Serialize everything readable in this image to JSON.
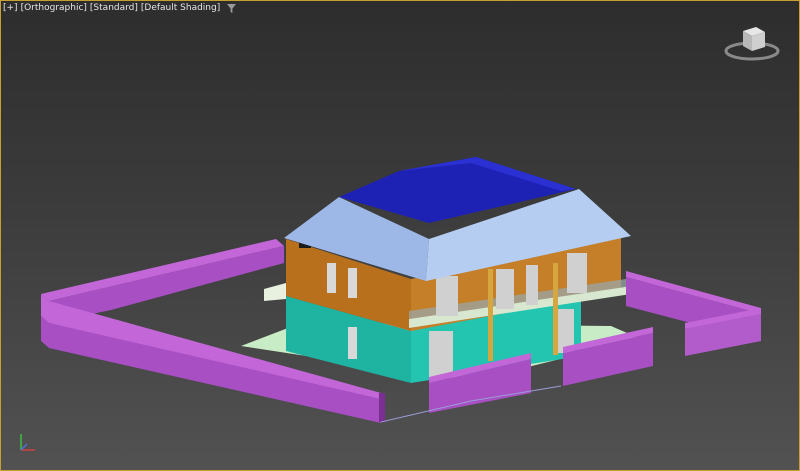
{
  "viewport": {
    "labels": [
      "[+]",
      "[Orthographic]",
      "[Standard]",
      "[Default Shading]"
    ],
    "filter_icon": "funnel-icon"
  },
  "icons": {
    "viewcube": "viewcube-icon",
    "gizmo": "axis-gizmo-icon"
  },
  "colors": {
    "viewport_border": "#c8a032",
    "wall": "#a84fc4",
    "roof_light": "#9db8e6",
    "roof_dark": "#1e22b4",
    "upper_floor": "#c27a22",
    "lower_floor": "#1fb3a2",
    "base": "#c8ecc6",
    "window": "#cfcfcf"
  }
}
